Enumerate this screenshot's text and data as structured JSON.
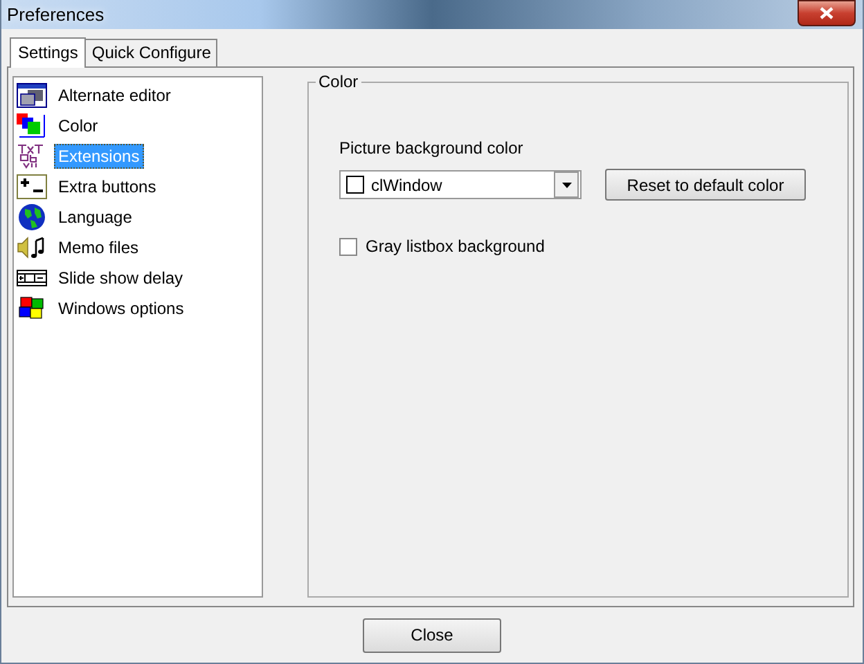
{
  "window": {
    "title": "Preferences"
  },
  "tabs": [
    {
      "label": "Settings",
      "selected": true
    },
    {
      "label": "Quick Configure",
      "selected": false
    }
  ],
  "sidebar": {
    "items": [
      {
        "label": "Alternate editor",
        "selected": false
      },
      {
        "label": "Color",
        "selected": false
      },
      {
        "label": "Extensions",
        "selected": true
      },
      {
        "label": "Extra buttons",
        "selected": false
      },
      {
        "label": "Language",
        "selected": false
      },
      {
        "label": "Memo files",
        "selected": false
      },
      {
        "label": "Slide show delay",
        "selected": false
      },
      {
        "label": "Windows options",
        "selected": false
      }
    ]
  },
  "group": {
    "title": "Color",
    "picture_background_label": "Picture background color",
    "dropdown_value": "clWindow",
    "reset_button": "Reset to default color",
    "gray_listbox": {
      "label": "Gray listbox background",
      "checked": false
    }
  },
  "buttons": [
    "Close"
  ]
}
